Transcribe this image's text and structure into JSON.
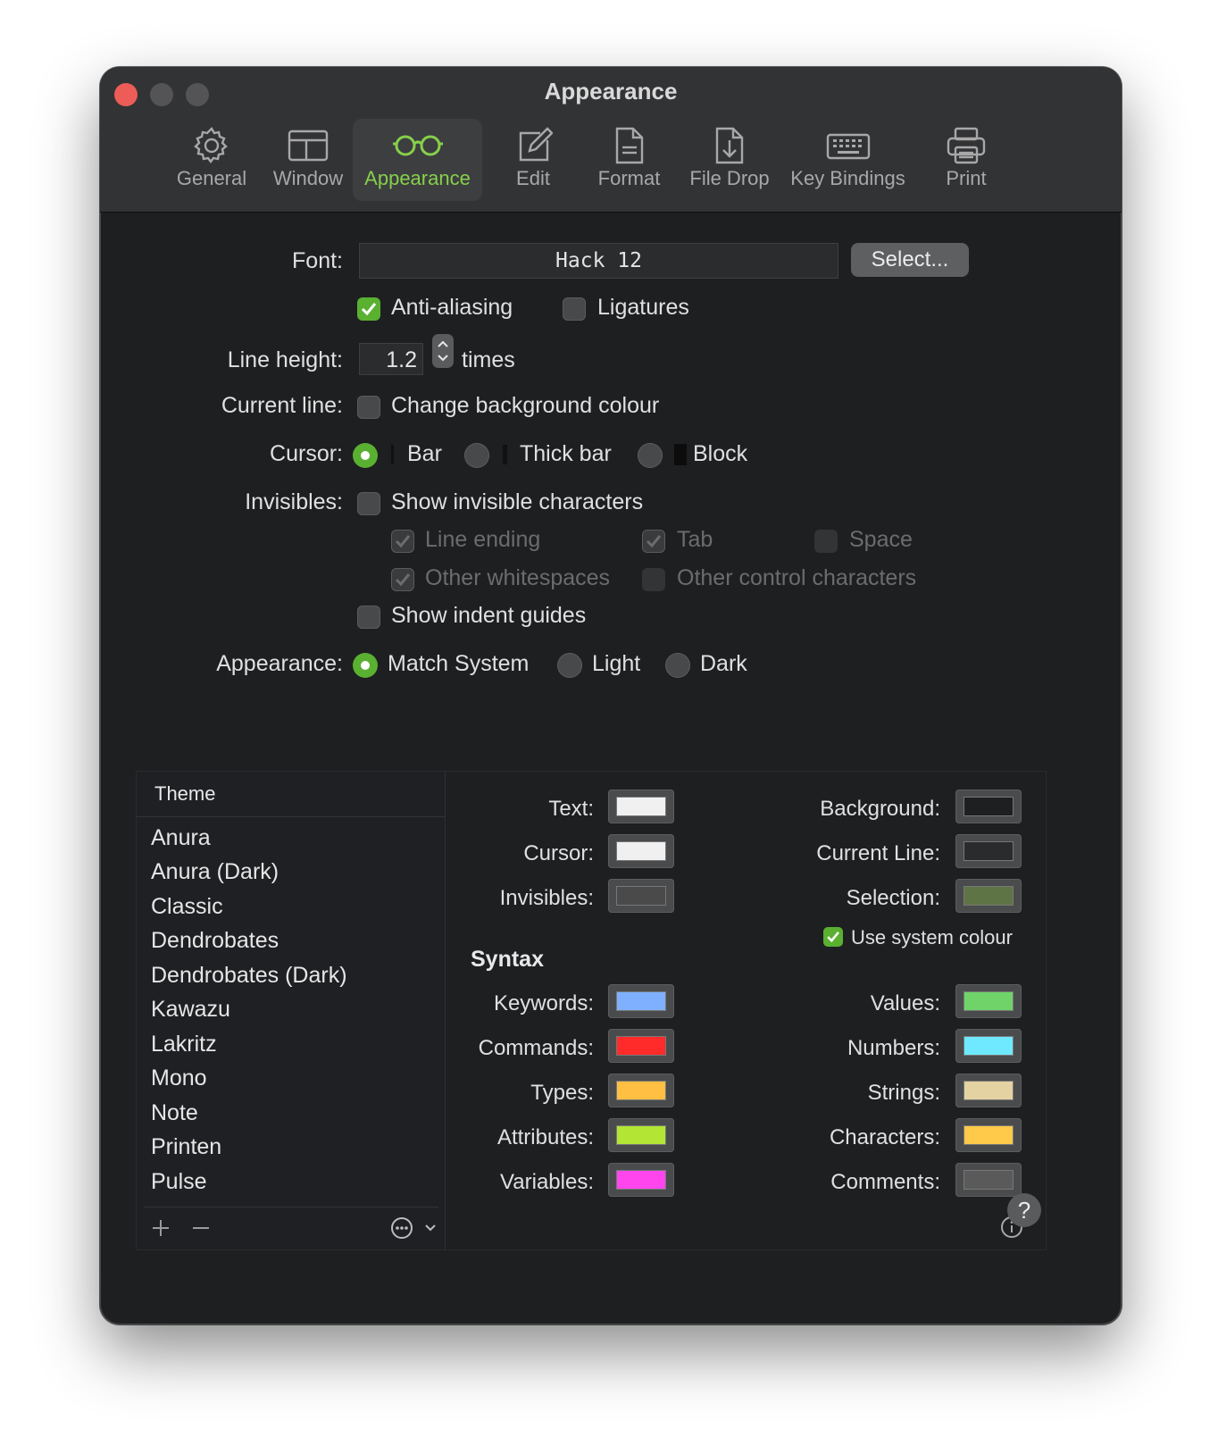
{
  "window": {
    "title": "Appearance"
  },
  "toolbar": {
    "tabs": [
      {
        "label": "General",
        "icon": "gear-icon"
      },
      {
        "label": "Window",
        "icon": "window-icon"
      },
      {
        "label": "Appearance",
        "icon": "glasses-icon",
        "active": true
      },
      {
        "label": "Edit",
        "icon": "pencil-square-icon"
      },
      {
        "label": "Format",
        "icon": "document-icon"
      },
      {
        "label": "File Drop",
        "icon": "file-download-icon"
      },
      {
        "label": "Key Bindings",
        "icon": "keyboard-icon"
      },
      {
        "label": "Print",
        "icon": "printer-icon"
      }
    ]
  },
  "font": {
    "label": "Font:",
    "value": "Hack  12",
    "select_button": "Select..."
  },
  "options": {
    "anti_aliasing": {
      "label": "Anti-aliasing",
      "checked": true
    },
    "ligatures": {
      "label": "Ligatures",
      "checked": false
    }
  },
  "line_height": {
    "label": "Line height:",
    "value": "1.2",
    "unit": "times"
  },
  "current_line": {
    "label": "Current line:",
    "option": "Change background colour",
    "checked": false
  },
  "cursor": {
    "label": "Cursor:",
    "options": [
      {
        "label": "Bar",
        "selected": true
      },
      {
        "label": "Thick bar",
        "selected": false
      },
      {
        "label": "Block",
        "selected": false
      }
    ]
  },
  "invisibles": {
    "label": "Invisibles:",
    "show": {
      "label": "Show invisible characters",
      "checked": false
    },
    "sub": {
      "line_ending": "Line ending",
      "tab": "Tab",
      "space": "Space",
      "other_whitespaces": "Other whitespaces",
      "other_control": "Other control characters"
    }
  },
  "indent_guides": {
    "label": "Show indent guides",
    "checked": false
  },
  "appearance": {
    "label": "Appearance:",
    "options": [
      {
        "label": "Match System",
        "selected": true
      },
      {
        "label": "Light",
        "selected": false
      },
      {
        "label": "Dark",
        "selected": false
      }
    ]
  },
  "themes": {
    "header": "Theme",
    "items": [
      "Anura",
      "Anura (Dark)",
      "Classic",
      "Dendrobates",
      "Dendrobates (Dark)",
      "Kawazu",
      "Lakritz",
      "Mono",
      "Note",
      "Printen",
      "Pulse"
    ]
  },
  "colors": {
    "text": {
      "label": "Text:",
      "color": "#f0f0f0"
    },
    "cursor": {
      "label": "Cursor:",
      "color": "#f0f0f0"
    },
    "invisibles": {
      "label": "Invisibles:",
      "color": "#4a4a4a"
    },
    "background": {
      "label": "Background:",
      "color": "#1e1f21"
    },
    "current_line": {
      "label": "Current Line:",
      "color": "#2a2b2d"
    },
    "selection": {
      "label": "Selection:",
      "color": "#5f7444"
    },
    "use_system": {
      "label": "Use system colour",
      "checked": true
    }
  },
  "syntax": {
    "header": "Syntax",
    "keywords": {
      "label": "Keywords:",
      "color": "#7fb0ff"
    },
    "commands": {
      "label": "Commands:",
      "color": "#ff2a2a"
    },
    "types": {
      "label": "Types:",
      "color": "#ffbf42"
    },
    "attributes": {
      "label": "Attributes:",
      "color": "#b3e634"
    },
    "variables": {
      "label": "Variables:",
      "color": "#ff45ee"
    },
    "values": {
      "label": "Values:",
      "color": "#6fd36a"
    },
    "numbers": {
      "label": "Numbers:",
      "color": "#6ee9ff"
    },
    "strings": {
      "label": "Strings:",
      "color": "#e4d2a2"
    },
    "characters": {
      "label": "Characters:",
      "color": "#ffc94a"
    },
    "comments": {
      "label": "Comments:",
      "color": "#5a5a5a"
    }
  },
  "accent": "#5ab031",
  "help": "?"
}
